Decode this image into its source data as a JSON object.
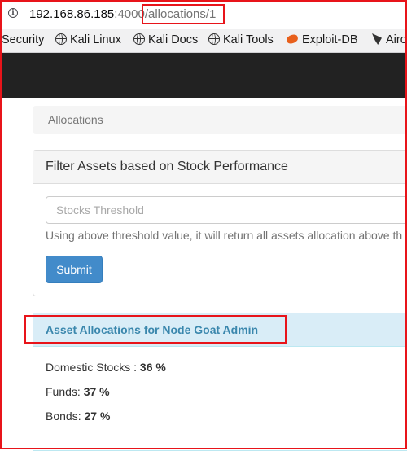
{
  "browser": {
    "url_host": "192.168.86.185",
    "url_port": ":4000",
    "url_path": "/allocations/1"
  },
  "bookmarks": [
    {
      "label": "Security",
      "icon": "none"
    },
    {
      "label": "Kali Linux",
      "icon": "globe-icon"
    },
    {
      "label": "Kali Docs",
      "icon": "globe-icon"
    },
    {
      "label": "Kali Tools",
      "icon": "globe-icon"
    },
    {
      "label": "Exploit-DB",
      "icon": "exploit-db-icon"
    },
    {
      "label": "Airc",
      "icon": "aircrack-icon"
    }
  ],
  "breadcrumb": "Allocations",
  "filter_panel": {
    "title": "Filter Assets based on Stock Performance",
    "input_placeholder": "Stocks Threshold",
    "help_text": "Using above threshold value, it will return all assets allocation above th",
    "submit_label": "Submit"
  },
  "allocations_panel": {
    "title": "Asset Allocations for Node Goat Admin",
    "rows": [
      {
        "label": "Domestic Stocks : ",
        "value": "36 %"
      },
      {
        "label": "Funds: ",
        "value": "37 %"
      },
      {
        "label": "Bonds: ",
        "value": "27 %"
      }
    ]
  },
  "colors": {
    "highlight": "#e8141a",
    "primary_button": "#428bca",
    "info_panel": "#d9edf7",
    "info_text": "#3a87ad"
  }
}
